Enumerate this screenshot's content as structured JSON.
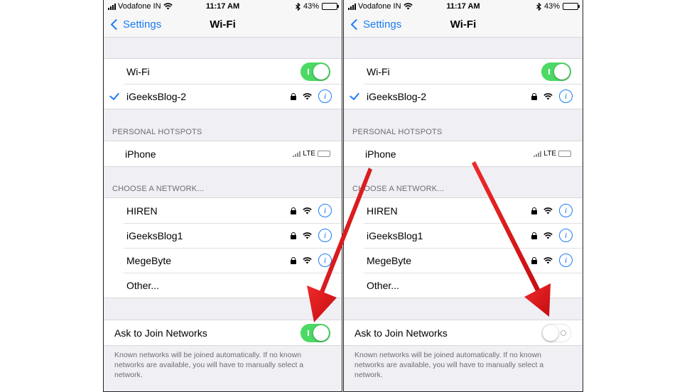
{
  "colors": {
    "accent": "#1a7cf5",
    "toggle_on": "#4cd964",
    "arrow": "#e0131a"
  },
  "panels": {
    "left": {
      "status": {
        "carrier": "Vodafone IN",
        "time": "11:17 AM",
        "battery": "43%"
      },
      "nav": {
        "back": "Settings",
        "title": "Wi-Fi"
      },
      "wifi_row": "Wi-Fi",
      "wifi_on": true,
      "connected_network": "iGeeksBlog-2",
      "hotspots_header": "PERSONAL HOTSPOTS",
      "hotspot": {
        "name": "iPhone",
        "network": "LTE"
      },
      "choose_header": "CHOOSE A NETWORK...",
      "networks": [
        "HIREN",
        "iGeeksBlog1",
        "MegeByte"
      ],
      "other": "Other...",
      "ask_label": "Ask to Join Networks",
      "ask_on": true,
      "footer": "Known networks will be joined automatically. If no known networks are available, you will have to manually select a network."
    },
    "right": {
      "status": {
        "carrier": "Vodafone IN",
        "time": "11:17 AM",
        "battery": "43%"
      },
      "nav": {
        "back": "Settings",
        "title": "Wi-Fi"
      },
      "wifi_row": "Wi-Fi",
      "wifi_on": true,
      "connected_network": "iGeeksBlog-2",
      "hotspots_header": "PERSONAL HOTSPOTS",
      "hotspot": {
        "name": "iPhone",
        "network": "LTE"
      },
      "choose_header": "CHOOSE A NETWORK...",
      "networks": [
        "HIREN",
        "iGeeksBlog1",
        "MegeByte"
      ],
      "other": "Other...",
      "ask_label": "Ask to Join Networks",
      "ask_on": false,
      "footer": "Known networks will be joined automatically. If no known networks are available, you will have to manually select a network."
    }
  },
  "icons": [
    "signal-icon",
    "wifi-icon",
    "bluetooth-icon",
    "battery-icon",
    "chevron-left-icon",
    "checkmark-icon",
    "lock-icon",
    "info-icon",
    "arrow-icon"
  ]
}
